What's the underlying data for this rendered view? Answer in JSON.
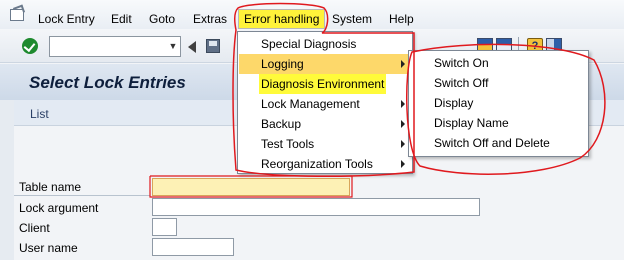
{
  "menubar": {
    "items": [
      {
        "label": "Lock Entry"
      },
      {
        "label": "Edit"
      },
      {
        "label": "Goto"
      },
      {
        "label": "Extras"
      },
      {
        "label": "Error handling"
      },
      {
        "label": "System"
      },
      {
        "label": "Help"
      }
    ]
  },
  "toolbar": {
    "command_field_value": "",
    "icons": [
      "enter-icon",
      "dropdown-icon",
      "back-icon",
      "save-icon",
      "grid-icon",
      "help-icon",
      "layout-icon"
    ]
  },
  "screen": {
    "title": "Select Lock Entries",
    "app_toolbar": {
      "list_label": "List"
    },
    "fields": [
      {
        "label": "Table name",
        "value": ""
      },
      {
        "label": "Lock argument",
        "value": ""
      },
      {
        "label": "Client",
        "value": ""
      },
      {
        "label": "User name",
        "value": ""
      }
    ]
  },
  "error_handling_menu": {
    "items": [
      {
        "label": "Special Diagnosis",
        "has_submenu": false
      },
      {
        "label": "Logging",
        "has_submenu": true,
        "active": true
      },
      {
        "label": "Diagnosis Environment",
        "has_submenu": false
      },
      {
        "label": "Lock Management",
        "has_submenu": true
      },
      {
        "label": "Backup",
        "has_submenu": true
      },
      {
        "label": "Test Tools",
        "has_submenu": true
      },
      {
        "label": "Reorganization Tools",
        "has_submenu": true
      }
    ]
  },
  "logging_submenu": {
    "items": [
      {
        "label": "Switch On"
      },
      {
        "label": "Switch Off"
      },
      {
        "label": "Display"
      },
      {
        "label": "Display Name"
      },
      {
        "label": "Switch Off and Delete"
      }
    ]
  },
  "colors": {
    "highlight_yellow": "#fff23a",
    "menu_active": "#fdd86a",
    "annotation_red": "#e0191e",
    "title_bar": "#d4deeb"
  }
}
